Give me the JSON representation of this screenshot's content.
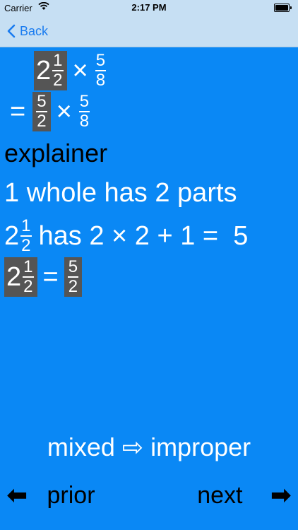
{
  "status_bar": {
    "carrier": "Carrier",
    "time": "2:17 PM"
  },
  "nav": {
    "back_label": "Back"
  },
  "problem": {
    "whole": "2",
    "frac1_num": "1",
    "frac1_den": "2",
    "times": "×",
    "frac2_num": "5",
    "frac2_den": "8"
  },
  "step": {
    "equals": "=",
    "improper_num": "5",
    "improper_den": "2",
    "times": "×",
    "frac2_num": "5",
    "frac2_den": "8"
  },
  "explainer": {
    "title": "explainer",
    "line1": "1 whole has 2 parts",
    "line2_whole": "2",
    "line2_num": "1",
    "line2_den": "2",
    "line2_text": "has 2 × 2 + 1 =  5",
    "line3_whole": "2",
    "line3_num": "1",
    "line3_den": "2",
    "line3_equals": "=",
    "line3_res_num": "5",
    "line3_res_den": "2"
  },
  "mode": {
    "label": "mixed ⇨ improper"
  },
  "footer": {
    "prior_label": "prior",
    "next_label": "next",
    "prior_arrow": "⬅",
    "next_arrow": "➡"
  }
}
